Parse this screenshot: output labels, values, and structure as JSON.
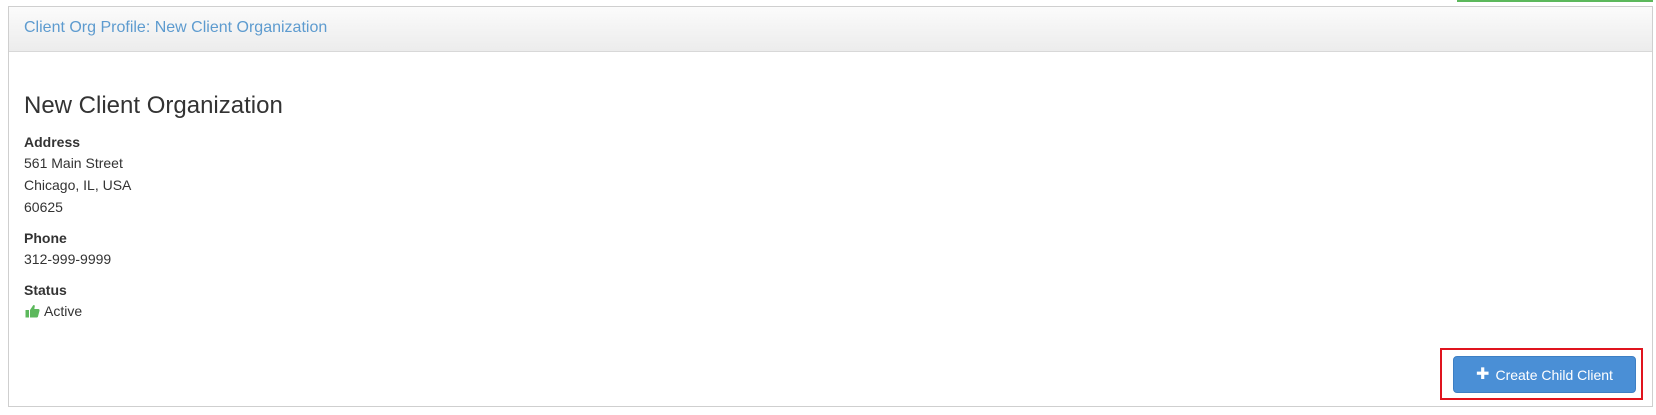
{
  "panel": {
    "heading": "Client Org Profile: New Client Organization"
  },
  "org": {
    "name": "New Client Organization",
    "address_label": "Address",
    "address_line1": "561 Main Street",
    "address_line2": "Chicago, IL, USA",
    "address_line3": "60625",
    "phone_label": "Phone",
    "phone": "312-999-9999",
    "status_label": "Status",
    "status": "Active",
    "status_icon": "thumbs-up-icon",
    "status_color": "#5cb85c"
  },
  "actions": {
    "create_child_label": "Create Child Client",
    "create_child_icon": "plus-icon",
    "button_color": "#4a8fd6",
    "highlight_color": "#e0141e"
  }
}
